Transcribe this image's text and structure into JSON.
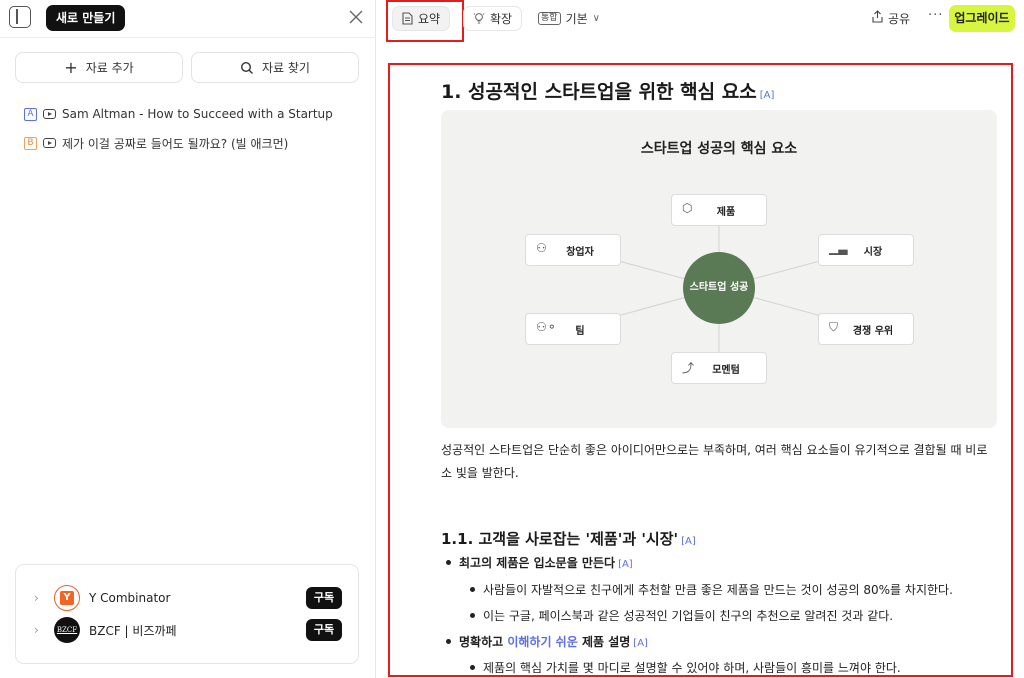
{
  "sidebar": {
    "new_button": "새로 만들기",
    "add_source": "자료 추가",
    "find_source": "자료 찾기",
    "sources": [
      {
        "badge": "A",
        "title": "Sam Altman - How to Succeed with a Startup"
      },
      {
        "badge": "B",
        "title": "제가 이걸 공짜로 들어도 될까요? (빌 애크먼)"
      }
    ],
    "channels": [
      {
        "name": "Y Combinator",
        "logo": "Y",
        "button": "구독"
      },
      {
        "name": "BZCF | 비즈까페",
        "logo": "BZCF",
        "button": "구독"
      }
    ]
  },
  "toolbar": {
    "tab_summary": "요약",
    "tab_expand": "확장",
    "mode_tag": "통합",
    "mode_value": "기본",
    "share": "공유",
    "more": "···",
    "upgrade": "업그레이드"
  },
  "doc": {
    "h1": "1. 성공적인 스타트업을 위한 핵심 요소",
    "h1_ref": "[A]",
    "diagram": {
      "title": "스타트업 성공의 핵심 요소",
      "center": "스타트업 성공",
      "nodes": {
        "product": "제품",
        "founder": "창업자",
        "market": "시장",
        "team": "팀",
        "moat": "경쟁 우위",
        "momentum": "모멘텀"
      }
    },
    "paragraph": "성공적인 스타트업은 단순히 좋은 아이디어만으로는 부족하며, 여러 핵심 요소들이 유기적으로 결합될 때 비로소 빛을 발한다.",
    "h2": "1.1. 고객을 사로잡는 '제품'과 '시장'",
    "h2_ref": "[A]",
    "bullet1": "최고의 제품은 입소문을 만든다",
    "bullet1_ref": "[A]",
    "bullet1_sub1": "사람들이 자발적으로 친구에게 추천할 만큼 좋은 제품을 만드는 것이 성공의 80%를 차지한다.",
    "bullet1_sub2": "이는 구글, 페이스북과 같은 성공적인 기업들이 친구의 추천으로 알려진 것과 같다.",
    "bullet2_a": "명확하고 ",
    "bullet2_hl": "이해하기 쉬운",
    "bullet2_b": " 제품 설명",
    "bullet2_ref": "[A]",
    "bullet2_sub1": "제품의 핵심 가치를 몇 마디로 설명할 수 있어야 하며, 사람들이 흥미를 느껴야 한다."
  },
  "colors": {
    "accent": "#d8f540",
    "hub": "#5a7a55",
    "ref": "#5b6fe8",
    "highlight_box": "#e21d1d"
  }
}
